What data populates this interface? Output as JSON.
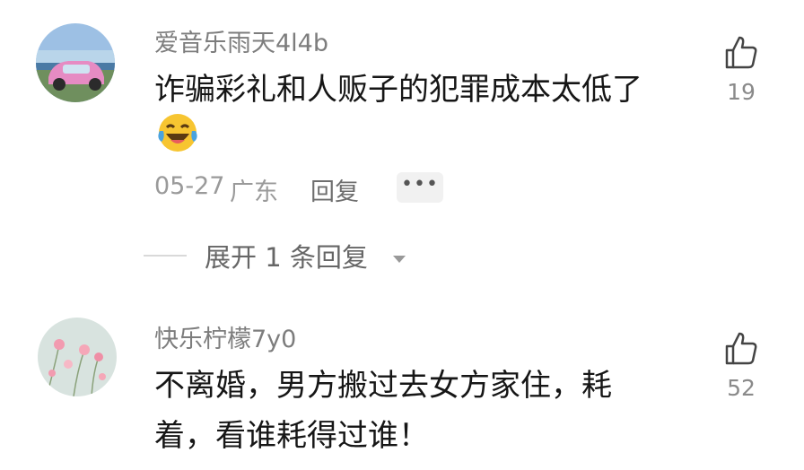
{
  "comments": [
    {
      "username": "爱音乐雨天4l4b",
      "content": "诈骗彩礼和人贩子的犯罪成本太低了",
      "emoji": "laughing-crying-emoji",
      "date": "05-27",
      "location": "广东",
      "reply_label": "回复",
      "more_label": "•••",
      "likes": "19"
    },
    {
      "username": "快乐柠檬7y0",
      "content_line1": "不离婚，男方搬过去女方家住，耗",
      "content_line2": "着，看谁耗得过谁！",
      "likes": "52"
    }
  ],
  "expand_replies": {
    "label": "展开 1 条回复"
  },
  "icons": {
    "like": "thumbs-up-icon",
    "expand": "caret-down-icon"
  },
  "colors": {
    "text": "#161616",
    "username": "#7d7d7d",
    "meta": "#9a9a9a",
    "emoji_face": "#f7c531",
    "emoji_tear": "#4aa3df"
  }
}
